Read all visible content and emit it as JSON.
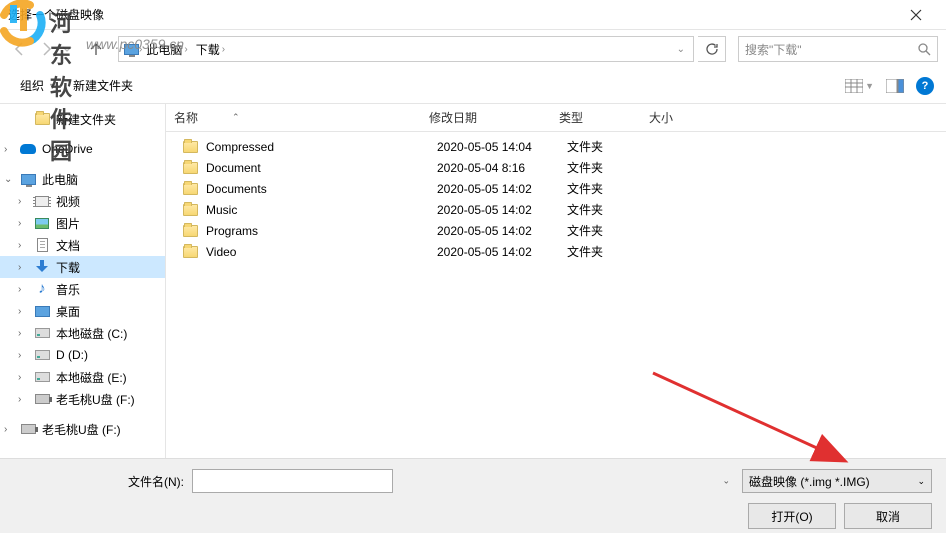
{
  "window": {
    "title": "选择一个磁盘映像"
  },
  "watermark": {
    "text": "河东软件园",
    "url": "www.pc0359.cn"
  },
  "nav": {
    "crumb_root_icon": "pc",
    "crumbs": [
      "此电脑",
      "下载"
    ],
    "refresh_icon": "refresh",
    "search_placeholder": "搜索\"下载\""
  },
  "toolbar": {
    "organize": "组织",
    "new_folder": "新建文件夹"
  },
  "tree": {
    "items": [
      {
        "icon": "folder",
        "label": "新建文件夹",
        "indent": true,
        "exp": ""
      },
      {
        "spacer": true
      },
      {
        "icon": "onedrive",
        "label": "OneDrive",
        "indent": false,
        "exp": ">"
      },
      {
        "spacer": true
      },
      {
        "icon": "pc",
        "label": "此电脑",
        "indent": false,
        "exp": "v"
      },
      {
        "icon": "video",
        "label": "视频",
        "indent": true,
        "exp": ">"
      },
      {
        "icon": "pic",
        "label": "图片",
        "indent": true,
        "exp": ">"
      },
      {
        "icon": "doc",
        "label": "文档",
        "indent": true,
        "exp": ">"
      },
      {
        "icon": "dl",
        "label": "下载",
        "indent": true,
        "exp": ">",
        "selected": true
      },
      {
        "icon": "music",
        "label": "音乐",
        "indent": true,
        "exp": ">"
      },
      {
        "icon": "desk",
        "label": "桌面",
        "indent": true,
        "exp": ">"
      },
      {
        "icon": "drive",
        "label": "本地磁盘 (C:)",
        "indent": true,
        "exp": ">"
      },
      {
        "icon": "drive",
        "label": "D (D:)",
        "indent": true,
        "exp": ">"
      },
      {
        "icon": "drive",
        "label": "本地磁盘 (E:)",
        "indent": true,
        "exp": ">"
      },
      {
        "icon": "usb",
        "label": "老毛桃U盘 (F:)",
        "indent": true,
        "exp": ">"
      },
      {
        "spacer": true
      },
      {
        "icon": "usb",
        "label": "老毛桃U盘 (F:)",
        "indent": false,
        "exp": ">"
      }
    ]
  },
  "columns": {
    "name": "名称",
    "date": "修改日期",
    "type": "类型",
    "size": "大小"
  },
  "files": [
    {
      "name": "Compressed",
      "date": "2020-05-05 14:04",
      "type": "文件夹",
      "size": ""
    },
    {
      "name": "Document",
      "date": "2020-05-04 8:16",
      "type": "文件夹",
      "size": ""
    },
    {
      "name": "Documents",
      "date": "2020-05-05 14:02",
      "type": "文件夹",
      "size": ""
    },
    {
      "name": "Music",
      "date": "2020-05-05 14:02",
      "type": "文件夹",
      "size": ""
    },
    {
      "name": "Programs",
      "date": "2020-05-05 14:02",
      "type": "文件夹",
      "size": ""
    },
    {
      "name": "Video",
      "date": "2020-05-05 14:02",
      "type": "文件夹",
      "size": ""
    }
  ],
  "footer": {
    "filename_label": "文件名(N):",
    "filter_label": "磁盘映像 (*.img *.IMG)",
    "open": "打开(O)",
    "cancel": "取消"
  }
}
